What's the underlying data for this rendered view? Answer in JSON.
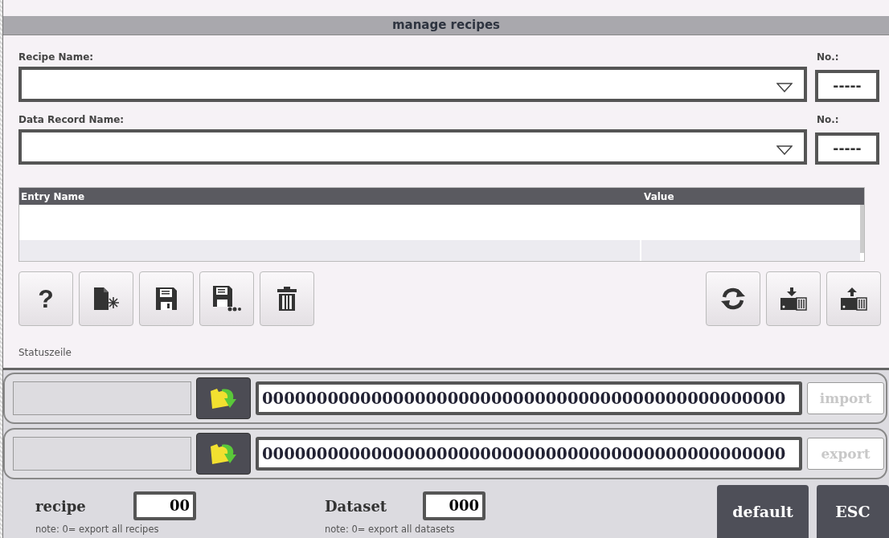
{
  "window": {
    "title": "manage recipes"
  },
  "recipe_name": {
    "label": "Recipe Name:",
    "number_label": "No.:",
    "number": "-----"
  },
  "data_record_name": {
    "label": "Data Record Name:",
    "number_label": "No.:",
    "number": "-----"
  },
  "table": {
    "columns": [
      "Entry Name",
      "Value"
    ]
  },
  "toolbar_left": [
    {
      "kind": "help",
      "text": "?"
    },
    {
      "kind": "new"
    },
    {
      "kind": "save"
    },
    {
      "kind": "save_as"
    },
    {
      "kind": "delete"
    }
  ],
  "toolbar_right": [
    {
      "kind": "refresh"
    },
    {
      "kind": "download"
    },
    {
      "kind": "upload"
    }
  ],
  "status_line": "Statuszeile",
  "transfer_rows": [
    {
      "path": "000000000000000000000000000000000000000000000000",
      "button": "import",
      "disabled": true
    },
    {
      "path": "000000000000000000000000000000000000000000000000",
      "button": "export",
      "disabled": true
    }
  ],
  "recipe": {
    "label": "recipe",
    "value": "00",
    "note": "note: 0= export all recipes"
  },
  "dataset": {
    "label": "Dataset",
    "value": "000",
    "note": "note: 0= export all datasets"
  },
  "buttons": [
    "default",
    "ESC"
  ]
}
